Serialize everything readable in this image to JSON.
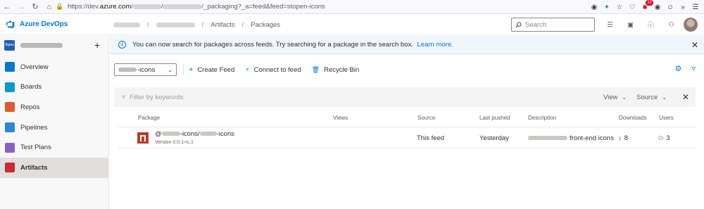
{
  "browser": {
    "url_prefix": "https://dev.",
    "url_domain": "azure.com",
    "url_sep1": "/",
    "url_sep2": "/",
    "url_suffix": "/_packaging?_a=feed&feed=stopen-icons",
    "extension_badge": "31"
  },
  "header": {
    "app_name": "Azure DevOps",
    "breadcrumb_sep": "/",
    "breadcrumb_artifacts": "Artifacts",
    "breadcrumb_packages": "Packages",
    "search_placeholder": "Search"
  },
  "sidebar": {
    "project_badge": "Stpen",
    "items": [
      {
        "label": "Overview",
        "icon": "overview-icon",
        "color": "#0078d4"
      },
      {
        "label": "Boards",
        "icon": "boards-icon",
        "color": "#009ccc"
      },
      {
        "label": "Repos",
        "icon": "repos-icon",
        "color": "#e05a2b"
      },
      {
        "label": "Pipelines",
        "icon": "pipelines-icon",
        "color": "#2b88d8"
      },
      {
        "label": "Test Plans",
        "icon": "test-plans-icon",
        "color": "#8661c5"
      },
      {
        "label": "Artifacts",
        "icon": "artifacts-icon",
        "color": "#cc2936"
      }
    ]
  },
  "info_bar": {
    "text": "You can now search for packages across feeds. Try searching for a package in the search box.",
    "link": "Learn more."
  },
  "toolbar": {
    "feed_name_suffix": "-icons",
    "create_feed": "Create Feed",
    "connect_feed": "Connect to feed",
    "recycle_bin": "Recycle Bin"
  },
  "filter": {
    "placeholder": "Filter by keywords",
    "view_label": "View",
    "source_label": "Source"
  },
  "table": {
    "columns": [
      "Package",
      "Views",
      "Source",
      "Last pushed",
      "Description",
      "Downloads",
      "Users"
    ],
    "rows": [
      {
        "name_at": "@",
        "name_mid": "-icons/",
        "name_end": "-icons",
        "version": "Version 0.0.1-rc.1",
        "source": "This feed",
        "last_pushed": "Yesterday",
        "description_visible": "front-end icons",
        "downloads": "8",
        "users": "3"
      }
    ]
  }
}
